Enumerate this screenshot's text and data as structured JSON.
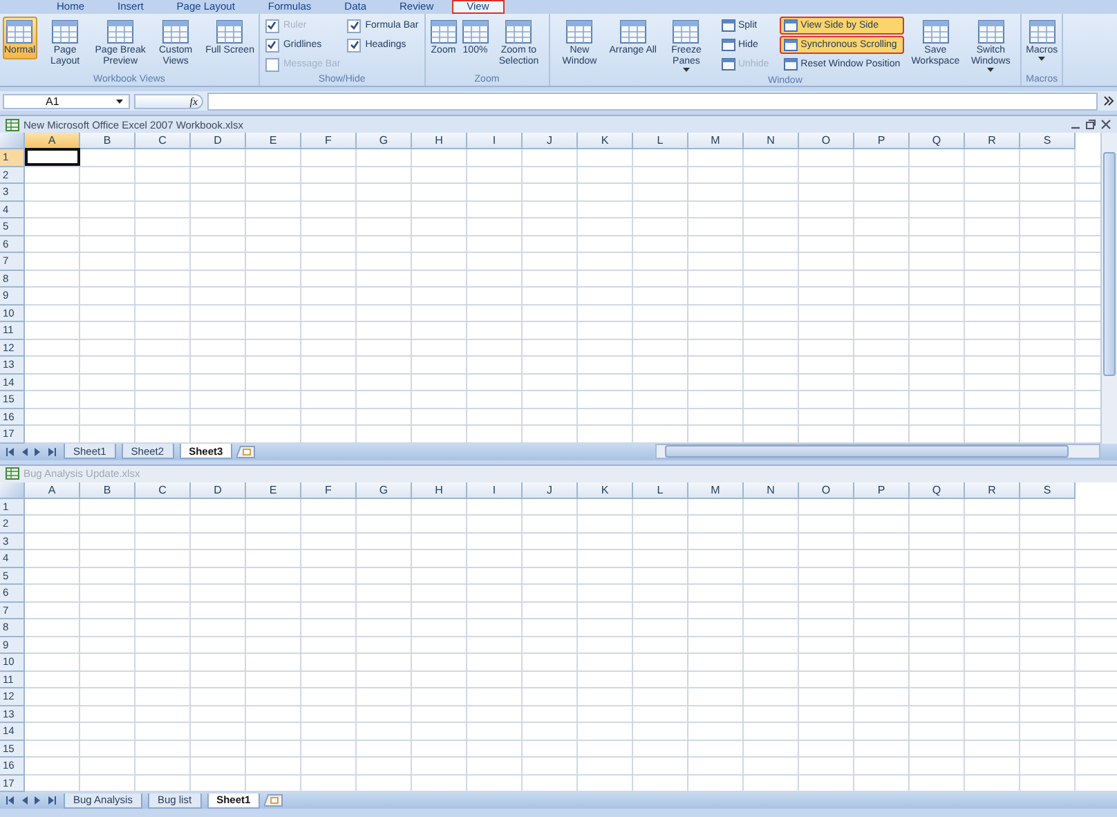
{
  "menu_tabs": [
    {
      "label": "Home",
      "selected": false
    },
    {
      "label": "Insert",
      "selected": false
    },
    {
      "label": "Page Layout",
      "selected": false
    },
    {
      "label": "Formulas",
      "selected": false
    },
    {
      "label": "Data",
      "selected": false
    },
    {
      "label": "Review",
      "selected": false
    },
    {
      "label": "View",
      "selected": true
    }
  ],
  "ribbon": {
    "groups": [
      {
        "label": "Workbook Views",
        "items": [
          {
            "kind": "large",
            "label": "Normal",
            "selected": true
          },
          {
            "kind": "large",
            "label": "Page Layout",
            "selected": false
          },
          {
            "kind": "large",
            "label": "Page Break Preview",
            "selected": false
          },
          {
            "kind": "large",
            "label": "Custom Views",
            "selected": false
          },
          {
            "kind": "large",
            "label": "Full Screen",
            "selected": false
          }
        ]
      },
      {
        "label": "Show/Hide",
        "items": [
          {
            "kind": "check",
            "label": "Ruler",
            "checked": true,
            "disabled": true
          },
          {
            "kind": "check",
            "label": "Gridlines",
            "checked": true,
            "disabled": false
          },
          {
            "kind": "check",
            "label": "Message Bar",
            "checked": false,
            "disabled": true
          },
          {
            "kind": "check",
            "label": "Formula Bar",
            "checked": true,
            "disabled": false
          },
          {
            "kind": "check",
            "label": "Headings",
            "checked": true,
            "disabled": false
          }
        ]
      },
      {
        "label": "Zoom",
        "items": [
          {
            "kind": "large",
            "label": "Zoom",
            "selected": false
          },
          {
            "kind": "large",
            "label": "100%",
            "selected": false
          },
          {
            "kind": "large",
            "label": "Zoom to Selection",
            "selected": false
          }
        ]
      },
      {
        "label": "Window",
        "items": [
          {
            "kind": "large",
            "label": "New Window",
            "selected": false
          },
          {
            "kind": "large",
            "label": "Arrange All",
            "selected": false
          },
          {
            "kind": "large",
            "label": "Freeze Panes",
            "selected": false,
            "dropdown": true
          },
          {
            "kind": "small",
            "label": "Split",
            "highlighted": false,
            "disabled": false
          },
          {
            "kind": "small",
            "label": "Hide",
            "highlighted": false,
            "disabled": false
          },
          {
            "kind": "small",
            "label": "Unhide",
            "highlighted": false,
            "disabled": true
          },
          {
            "kind": "small",
            "label": "View Side by Side",
            "highlighted": true,
            "disabled": false
          },
          {
            "kind": "small",
            "label": "Synchronous Scrolling",
            "highlighted": true,
            "disabled": false
          },
          {
            "kind": "small",
            "label": "Reset Window Position",
            "highlighted": false,
            "disabled": false
          },
          {
            "kind": "large",
            "label": "Save Workspace",
            "selected": false
          },
          {
            "kind": "large",
            "label": "Switch Windows",
            "selected": false,
            "dropdown": true
          }
        ]
      },
      {
        "label": "Macros",
        "items": [
          {
            "kind": "large",
            "label": "Macros",
            "selected": false,
            "dropdown": true
          }
        ]
      }
    ]
  },
  "formula_bar": {
    "name_box": "A1",
    "function_label": "fx"
  },
  "windows": [
    {
      "title": "New Microsoft Office Excel 2007 Workbook.xlsx",
      "active": true,
      "columns": [
        {
          "label": "A",
          "selected": true
        },
        {
          "label": "B",
          "selected": false
        },
        {
          "label": "C",
          "selected": false
        },
        {
          "label": "D",
          "selected": false
        },
        {
          "label": "E",
          "selected": false
        },
        {
          "label": "F",
          "selected": false
        },
        {
          "label": "G",
          "selected": false
        },
        {
          "label": "H",
          "selected": false
        },
        {
          "label": "I",
          "selected": false
        },
        {
          "label": "J",
          "selected": false
        },
        {
          "label": "K",
          "selected": false
        },
        {
          "label": "L",
          "selected": false
        },
        {
          "label": "M",
          "selected": false
        },
        {
          "label": "N",
          "selected": false
        },
        {
          "label": "O",
          "selected": false
        },
        {
          "label": "P",
          "selected": false
        },
        {
          "label": "Q",
          "selected": false
        },
        {
          "label": "R",
          "selected": false
        },
        {
          "label": "S",
          "selected": false
        }
      ],
      "rows": [
        {
          "label": "1",
          "selected": true
        },
        {
          "label": "2",
          "selected": false
        },
        {
          "label": "3",
          "selected": false
        },
        {
          "label": "4",
          "selected": false
        },
        {
          "label": "5",
          "selected": false
        },
        {
          "label": "6",
          "selected": false
        },
        {
          "label": "7",
          "selected": false
        },
        {
          "label": "8",
          "selected": false
        },
        {
          "label": "9",
          "selected": false
        },
        {
          "label": "10",
          "selected": false
        },
        {
          "label": "11",
          "selected": false
        },
        {
          "label": "12",
          "selected": false
        },
        {
          "label": "13",
          "selected": false
        },
        {
          "label": "14",
          "selected": false
        },
        {
          "label": "15",
          "selected": false
        },
        {
          "label": "16",
          "selected": false
        },
        {
          "label": "17",
          "selected": false
        }
      ],
      "sheets": [
        {
          "label": "Sheet1",
          "selected": false
        },
        {
          "label": "Sheet2",
          "selected": false
        },
        {
          "label": "Sheet3",
          "selected": true
        }
      ]
    },
    {
      "title": "Bug Analysis Update.xlsx",
      "active": false,
      "columns": [
        {
          "label": "A",
          "selected": false
        },
        {
          "label": "B",
          "selected": false
        },
        {
          "label": "C",
          "selected": false
        },
        {
          "label": "D",
          "selected": false
        },
        {
          "label": "E",
          "selected": false
        },
        {
          "label": "F",
          "selected": false
        },
        {
          "label": "G",
          "selected": false
        },
        {
          "label": "H",
          "selected": false
        },
        {
          "label": "I",
          "selected": false
        },
        {
          "label": "J",
          "selected": false
        },
        {
          "label": "K",
          "selected": false
        },
        {
          "label": "L",
          "selected": false
        },
        {
          "label": "M",
          "selected": false
        },
        {
          "label": "N",
          "selected": false
        },
        {
          "label": "O",
          "selected": false
        },
        {
          "label": "P",
          "selected": false
        },
        {
          "label": "Q",
          "selected": false
        },
        {
          "label": "R",
          "selected": false
        },
        {
          "label": "S",
          "selected": false
        }
      ],
      "rows": [
        {
          "label": "1",
          "selected": false
        },
        {
          "label": "2",
          "selected": false
        },
        {
          "label": "3",
          "selected": false
        },
        {
          "label": "4",
          "selected": false
        },
        {
          "label": "5",
          "selected": false
        },
        {
          "label": "6",
          "selected": false
        },
        {
          "label": "7",
          "selected": false
        },
        {
          "label": "8",
          "selected": false
        },
        {
          "label": "9",
          "selected": false
        },
        {
          "label": "10",
          "selected": false
        },
        {
          "label": "11",
          "selected": false
        },
        {
          "label": "12",
          "selected": false
        },
        {
          "label": "13",
          "selected": false
        },
        {
          "label": "14",
          "selected": false
        },
        {
          "label": "15",
          "selected": false
        },
        {
          "label": "16",
          "selected": false
        },
        {
          "label": "17",
          "selected": false
        }
      ],
      "sheets": [
        {
          "label": "Bug Analysis",
          "selected": false
        },
        {
          "label": "Bug list",
          "selected": false
        },
        {
          "label": "Sheet1",
          "selected": true
        }
      ]
    }
  ]
}
